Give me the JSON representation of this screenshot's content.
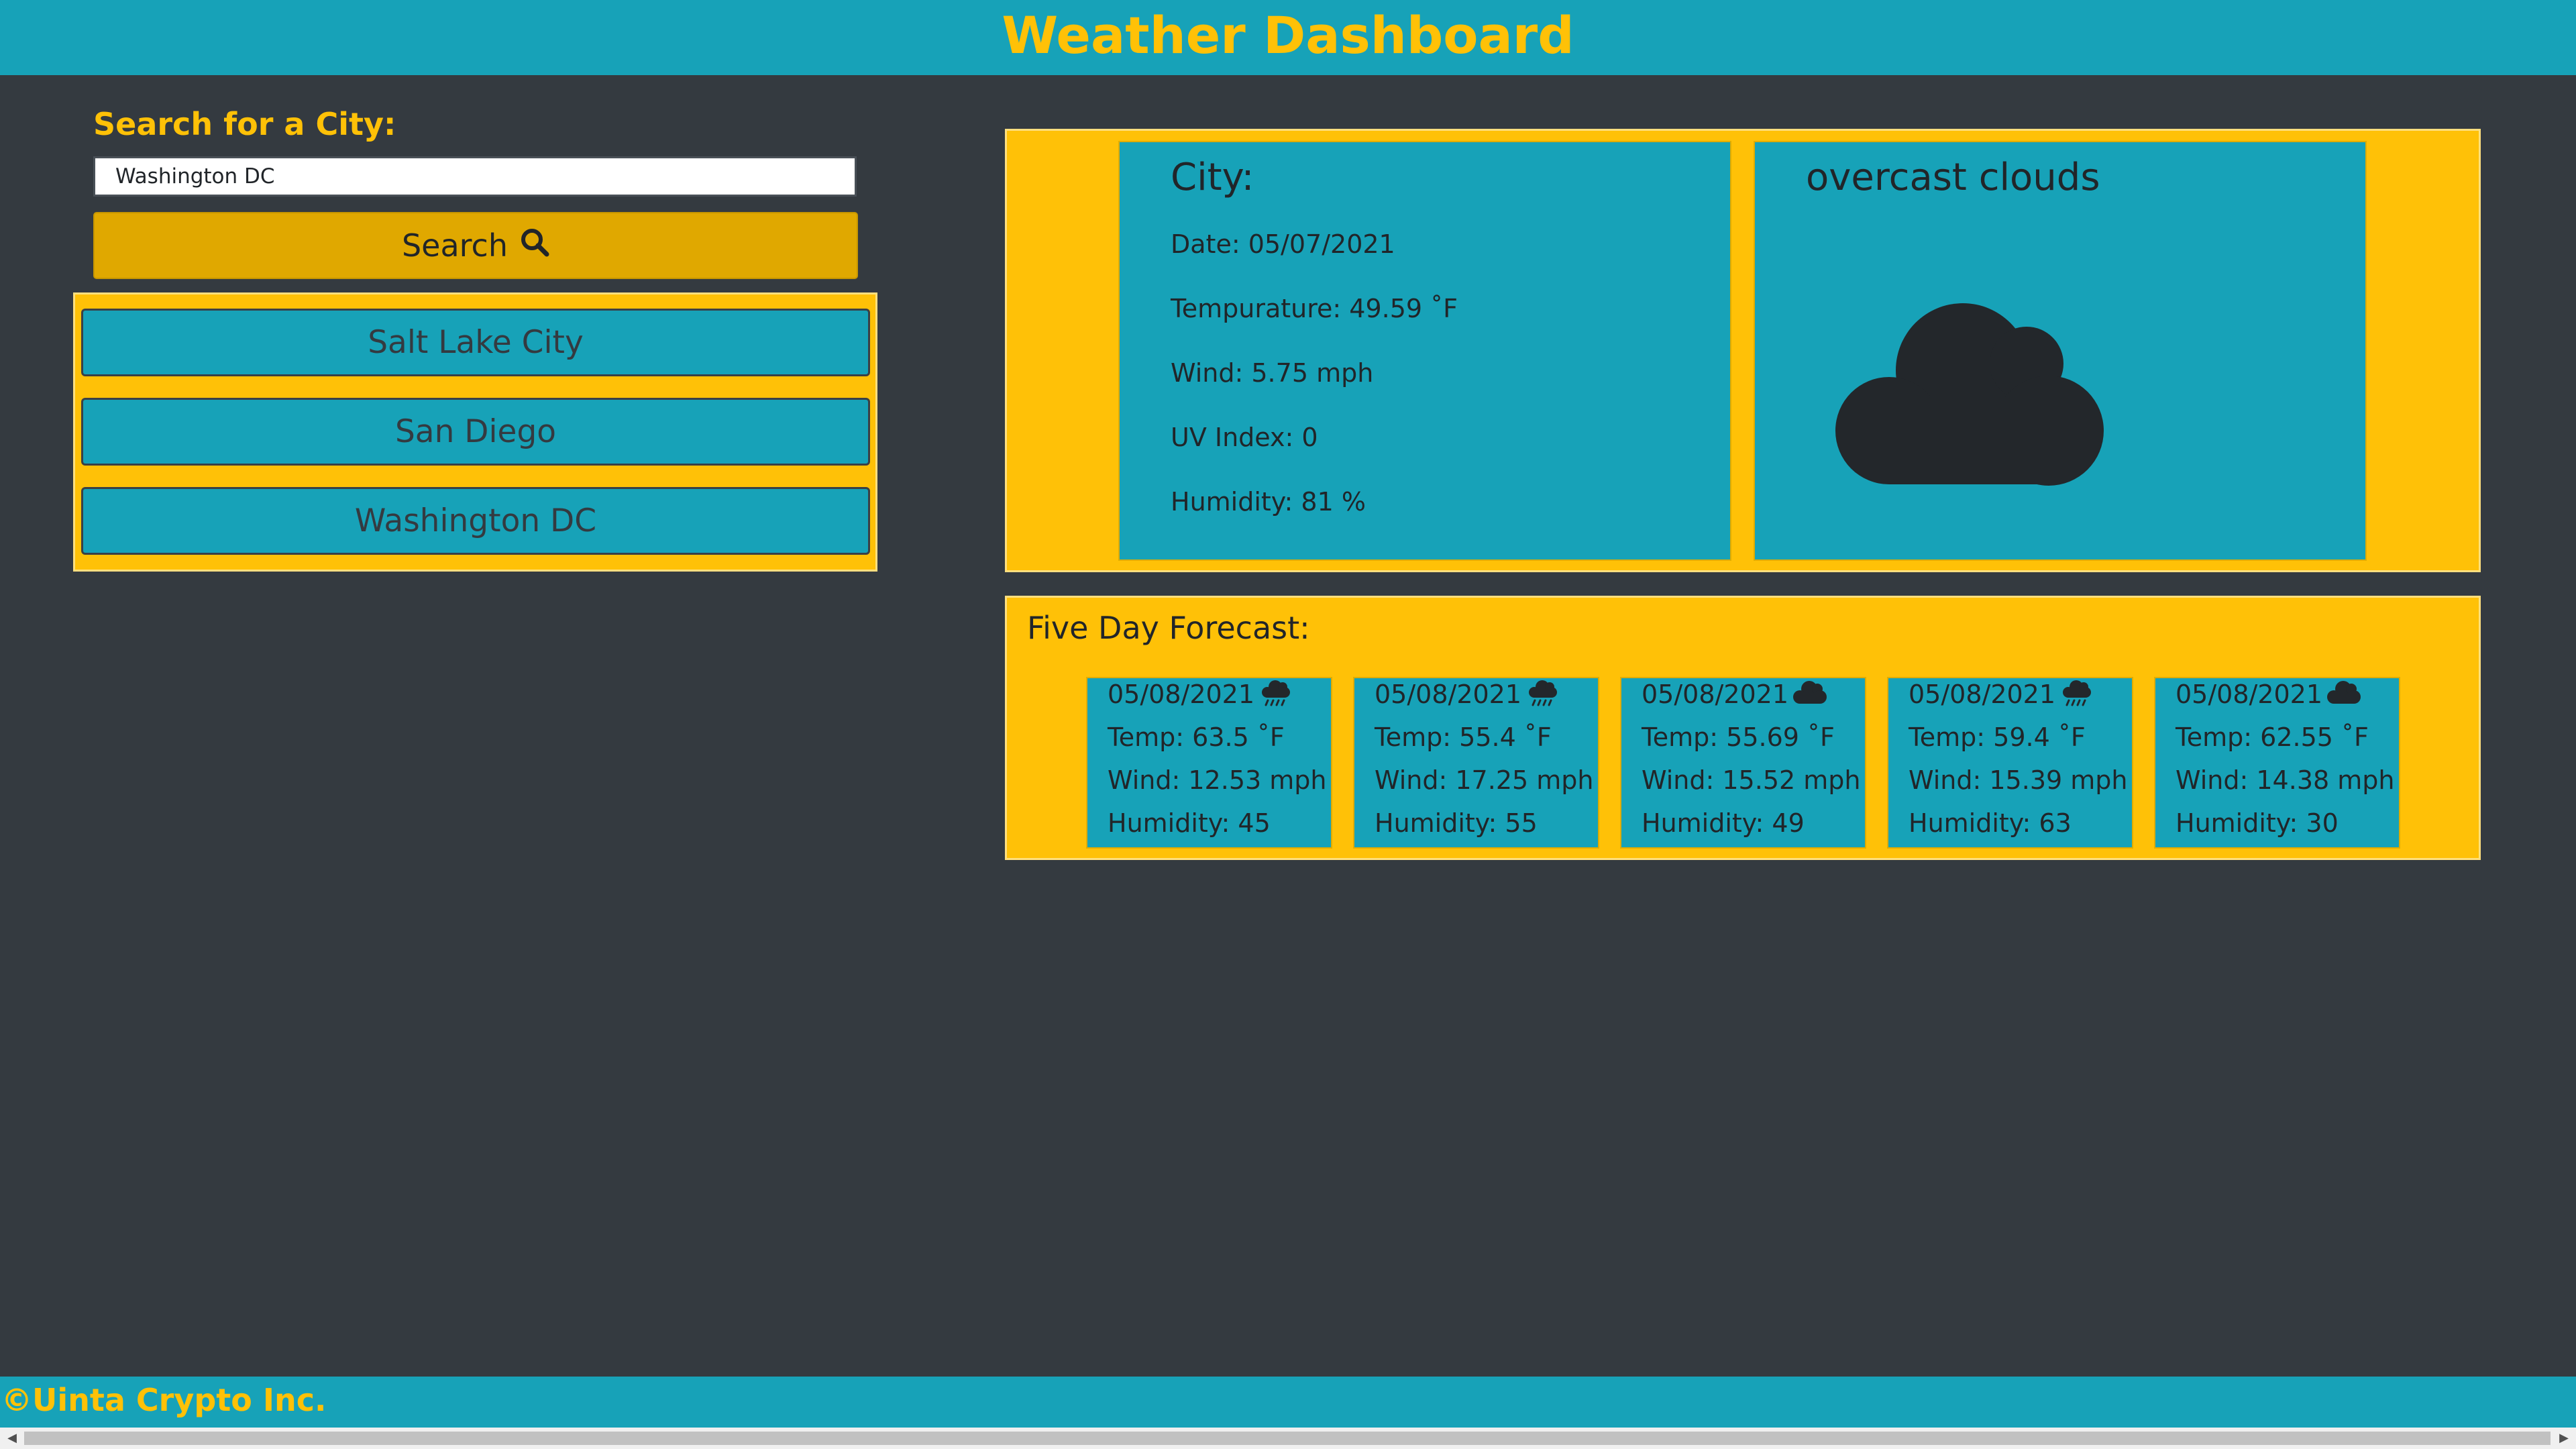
{
  "header": {
    "title": "Weather Dashboard"
  },
  "search": {
    "label": "Search for a City:",
    "value": "Washington DC",
    "button_label": "Search",
    "button_icon": "search-icon"
  },
  "history": {
    "items": [
      {
        "label": "Salt Lake City"
      },
      {
        "label": "San Diego"
      },
      {
        "label": "Washington DC"
      }
    ]
  },
  "current": {
    "city_label": "City:",
    "date": "Date: 05/07/2021",
    "temperature": "Tempurature: 49.59 ˚F",
    "wind": "Wind: 5.75 mph",
    "uv": "UV Index: 0",
    "humidity": "Humidity: 81 %",
    "condition": "overcast clouds",
    "icon": "cloud-icon"
  },
  "forecast": {
    "title": "Five Day Forecast:",
    "days": [
      {
        "date": "05/08/2021",
        "icon": "rain-cloud-icon",
        "temp": "Temp: 63.5 ˚F",
        "wind": "Wind: 12.53 mph",
        "humidity": "Humidity: 45"
      },
      {
        "date": "05/08/2021",
        "icon": "rain-cloud-icon",
        "temp": "Temp: 55.4 ˚F",
        "wind": "Wind: 17.25 mph",
        "humidity": "Humidity: 55"
      },
      {
        "date": "05/08/2021",
        "icon": "cloud-icon",
        "temp": "Temp: 55.69 ˚F",
        "wind": "Wind: 15.52 mph",
        "humidity": "Humidity: 49"
      },
      {
        "date": "05/08/2021",
        "icon": "rain-cloud-icon",
        "temp": "Temp: 59.4 ˚F",
        "wind": "Wind: 15.39 mph",
        "humidity": "Humidity: 63"
      },
      {
        "date": "05/08/2021",
        "icon": "cloud-icon",
        "temp": "Temp: 62.55 ˚F",
        "wind": "Wind: 14.38 mph",
        "humidity": "Humidity: 30"
      }
    ]
  },
  "footer": {
    "text": "©Uinta Crypto Inc."
  },
  "colors": {
    "background": "#343a40",
    "accent": "#17a2b8",
    "warning": "#ffc107",
    "button": "#e0a800"
  }
}
